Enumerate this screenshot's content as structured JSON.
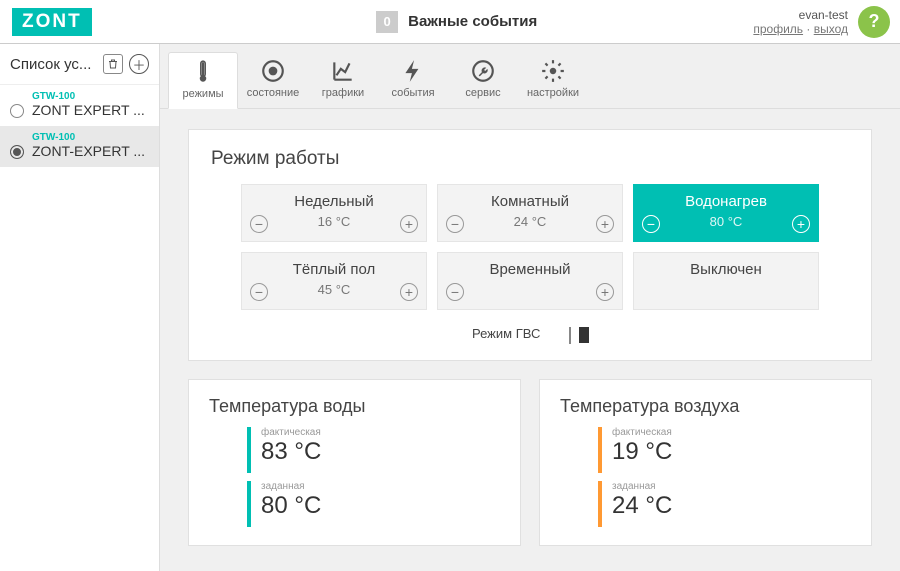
{
  "brand": "ZONT",
  "header": {
    "events_count": "0",
    "events_label": "Важные события",
    "username": "evan-test",
    "profile_link": "профиль",
    "logout_link": "выход",
    "help_glyph": "?"
  },
  "sidebar": {
    "title": "Список ус...",
    "devices": [
      {
        "model": "GTW-100",
        "name": "ZONT EXPERT ..."
      },
      {
        "model": "GTW-100",
        "name": "ZONT-EXPERT ..."
      }
    ],
    "active_index": 1
  },
  "tabs": [
    {
      "id": "modes",
      "label": "режимы"
    },
    {
      "id": "status",
      "label": "состояние"
    },
    {
      "id": "charts",
      "label": "графики"
    },
    {
      "id": "events",
      "label": "события"
    },
    {
      "id": "service",
      "label": "сервис"
    },
    {
      "id": "settings",
      "label": "настройки"
    }
  ],
  "active_tab": "modes",
  "mode_panel": {
    "title": "Режим работы",
    "modes": [
      {
        "name": "Недельный",
        "temp": "16 °C",
        "adjustable": true
      },
      {
        "name": "Комнатный",
        "temp": "24 °C",
        "adjustable": true
      },
      {
        "name": "Водонагрев",
        "temp": "80 °C",
        "adjustable": true,
        "active": true
      },
      {
        "name": "Тёплый пол",
        "temp": "45 °C",
        "adjustable": true
      },
      {
        "name": "Временный",
        "temp": "",
        "adjustable": true
      },
      {
        "name": "Выключен",
        "temp": "",
        "adjustable": false
      }
    ],
    "gvs_label": "Режим ГВС",
    "gvs_on": true
  },
  "temp_water": {
    "title": "Температура воды",
    "actual_label": "фактическая",
    "actual_value": "83 °C",
    "target_label": "заданная",
    "target_value": "80 °C"
  },
  "temp_air": {
    "title": "Температура воздуха",
    "actual_label": "фактическая",
    "actual_value": "19 °C",
    "target_label": "заданная",
    "target_value": "24 °C"
  }
}
